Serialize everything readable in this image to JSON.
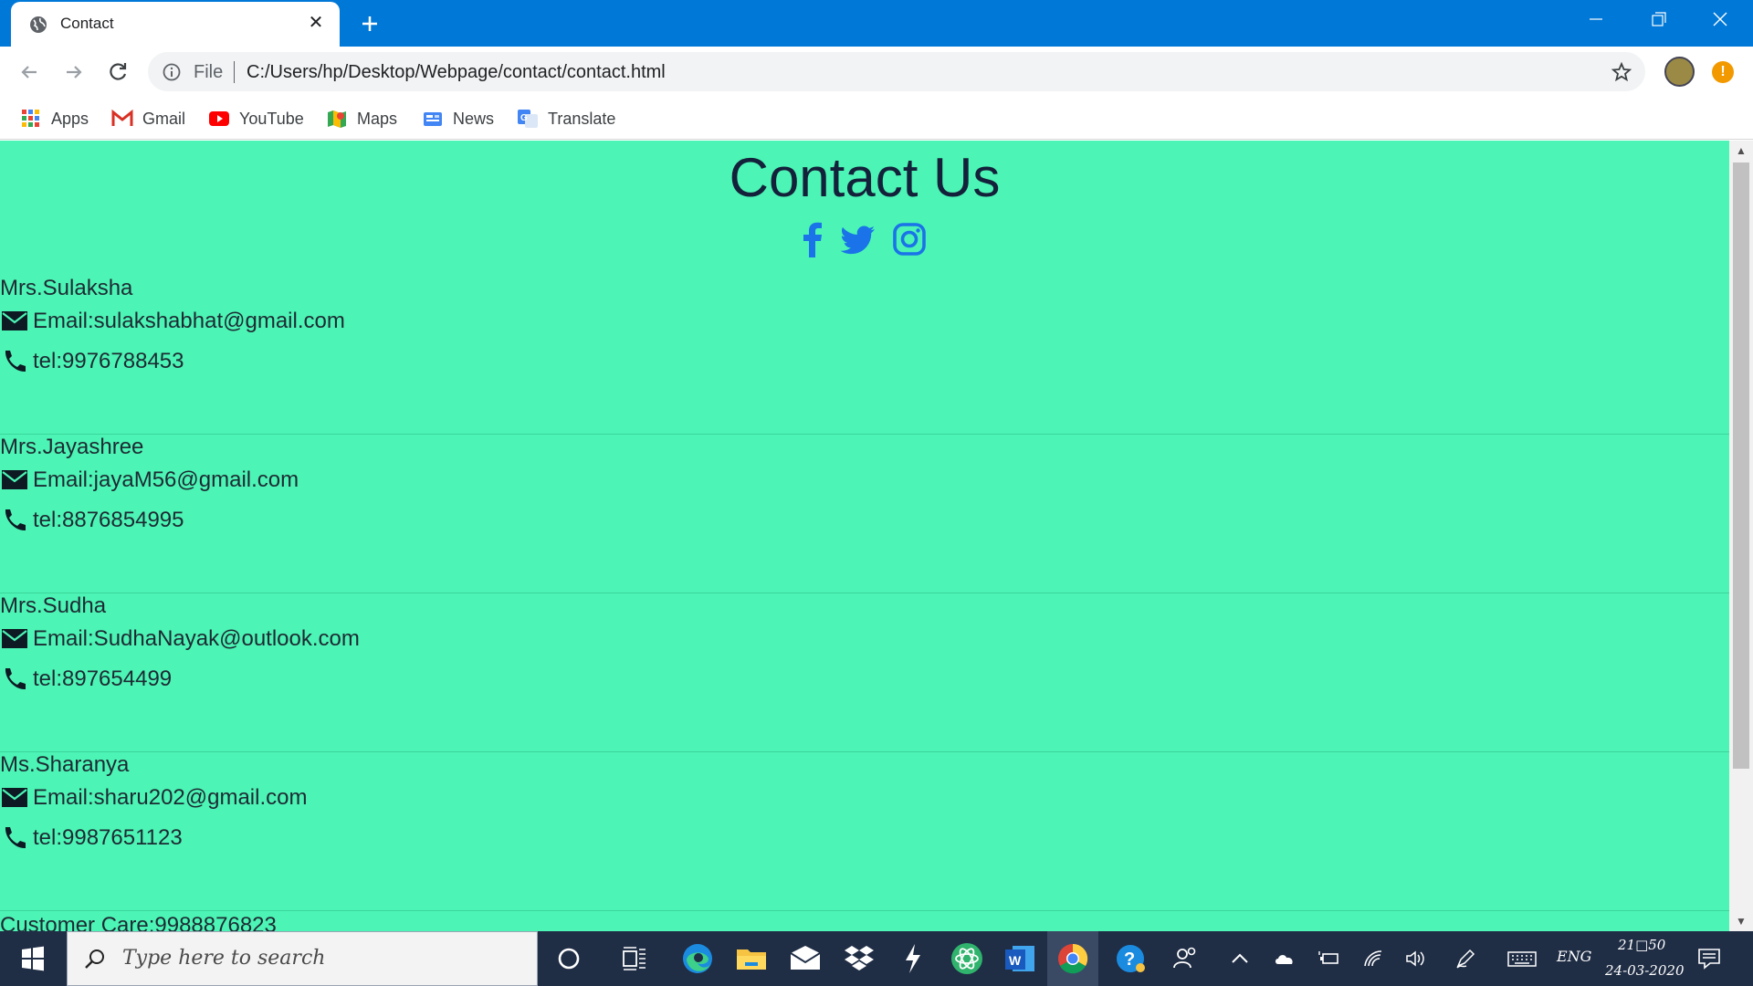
{
  "browser": {
    "tab": {
      "title": "Contact",
      "favicon": "globe-icon",
      "close": "✕"
    },
    "new_tab": "plus-icon",
    "address": {
      "scheme_label": "File",
      "url": "C:/Users/hp/Desktop/Webpage/contact/contact.html"
    },
    "bookmarks": [
      {
        "label": "Apps",
        "icon": "apps-grid-icon"
      },
      {
        "label": "Gmail",
        "icon": "gmail-icon"
      },
      {
        "label": "YouTube",
        "icon": "youtube-icon"
      },
      {
        "label": "Maps",
        "icon": "maps-icon"
      },
      {
        "label": "News",
        "icon": "news-icon"
      },
      {
        "label": "Translate",
        "icon": "translate-icon"
      }
    ],
    "alert": "!"
  },
  "page": {
    "title": "Contact Us",
    "background": "#4cf5b5",
    "socials": [
      "facebook-icon",
      "twitter-icon",
      "instagram-icon"
    ],
    "social_color": "#1a73e8",
    "contacts": [
      {
        "name": "Mrs.Sulaksha",
        "email": "Email:sulakshabhat@gmail.com",
        "tel": "tel:9976788453"
      },
      {
        "name": "Mrs.Jayashree",
        "email": "Email:jayaM56@gmail.com",
        "tel": "tel:8876854995"
      },
      {
        "name": "Mrs.Sudha",
        "email": "Email:SudhaNayak@outlook.com",
        "tel": "tel:897654499"
      },
      {
        "name": "Ms.Sharanya",
        "email": "Email:sharu202@gmail.com",
        "tel": "tel:9987651123"
      }
    ],
    "customer_care": "Customer Care:9988876823"
  },
  "taskbar": {
    "search_placeholder": "Type here to search",
    "language": "ENG",
    "time": "21□50",
    "date": "24-03-2020",
    "color": "#1f2d45"
  }
}
